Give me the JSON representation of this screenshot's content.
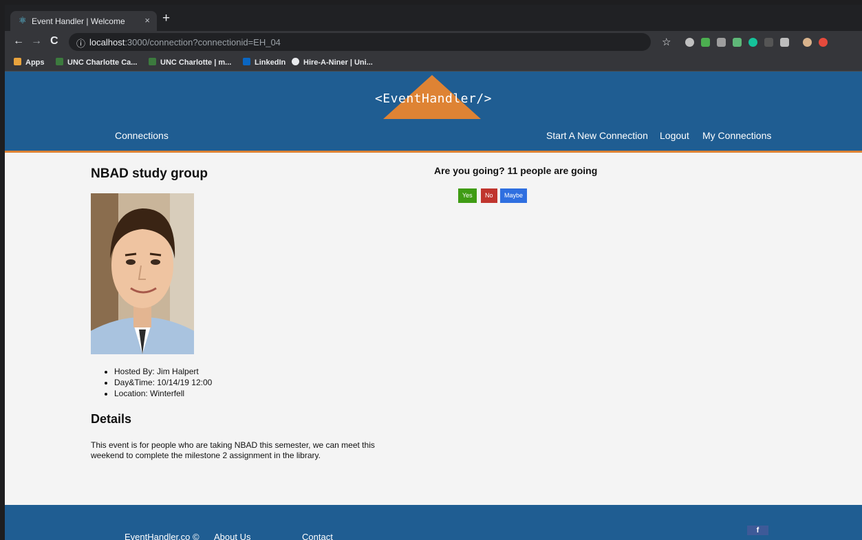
{
  "browser": {
    "tab_title": "Event Handler | Welcome",
    "tab_close": "×",
    "new_tab": "+",
    "url_host": "localhost",
    "url_rest": ":3000/connection?connectionid=EH_04",
    "bookmarks": [
      {
        "label": "Apps",
        "color": "#e8a33d"
      },
      {
        "label": "UNC Charlotte Ca...",
        "color": "#3c7a3e"
      },
      {
        "label": "UNC Charlotte | m...",
        "color": "#3c7a3e"
      },
      {
        "label": "LinkedIn",
        "color": "#0a66c2"
      },
      {
        "label": "Hire-A-Niner | Uni...",
        "color": "#e8eaed"
      }
    ]
  },
  "site": {
    "logo": "<EventHandler/>",
    "nav": {
      "connections": "Connections",
      "start_new": "Start A New Connection",
      "logout": "Logout",
      "my_connections": "My Connections"
    },
    "colors": {
      "header": "#1f5d92",
      "accent": "#de8334"
    }
  },
  "event": {
    "title": "NBAD study group",
    "hosted_by": "Hosted By: Jim Halpert",
    "datetime": "Day&Time: 10/14/19 12:00",
    "location": "Location: Winterfell",
    "details_heading": "Details",
    "details_text": "This event is for people who are taking NBAD this semester, we can meet this weekend to complete the milestone 2 assignment in the library."
  },
  "rsvp": {
    "question": "Are you going? 11 people are going",
    "yes": "Yes",
    "no": "No",
    "maybe": "Maybe"
  },
  "footer": {
    "copyright": "EventHandler.co ©",
    "about": "About Us",
    "contact": "Contact",
    "social": "f"
  }
}
